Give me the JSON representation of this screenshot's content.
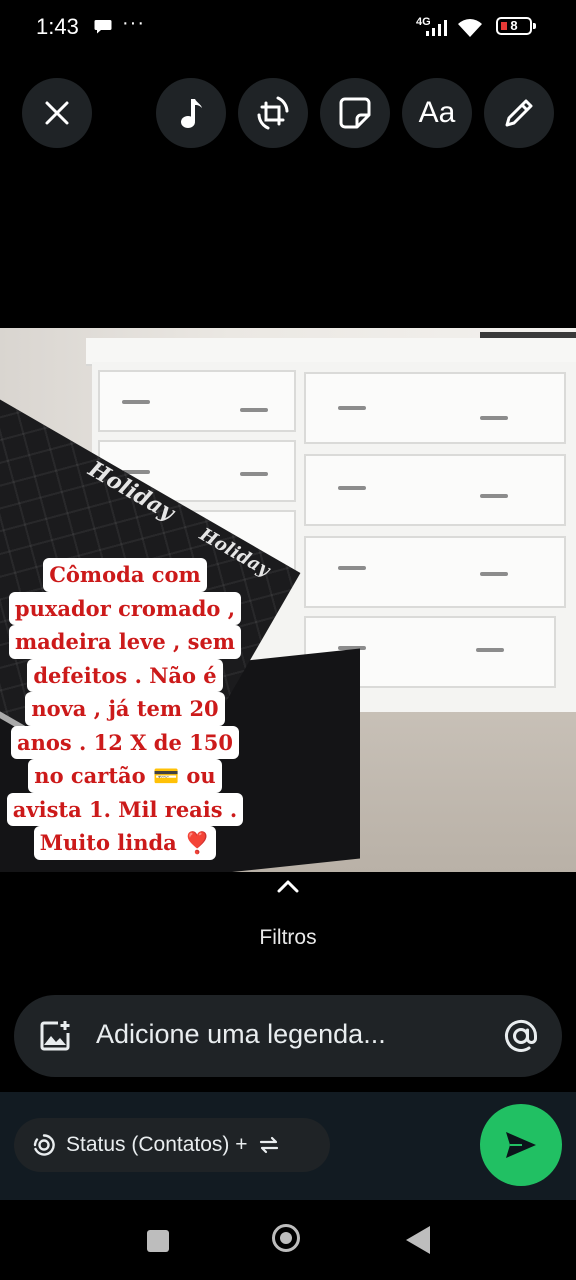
{
  "status_bar": {
    "time": "1:43",
    "dots": "···",
    "network": "4G",
    "battery": "8"
  },
  "toolbar": {
    "close_icon": "close-icon",
    "music_icon": "music-note-icon",
    "crop_icon": "crop-rotate-icon",
    "sticker_icon": "sticker-icon",
    "text_label": "Aa",
    "draw_icon": "pencil-icon"
  },
  "photo": {
    "brand_text_1": "Holiday",
    "brand_text_2": "Holiday",
    "caption_lines": [
      "Cômoda com",
      "puxador cromado ,",
      "madeira leve , sem",
      "defeitos . Não é",
      "nova , já tem 20",
      "anos .  12 X de 150",
      "no cartão 💳  ou",
      "avista 1. Mil reais .",
      "Muito linda ❣️"
    ]
  },
  "filters": {
    "label": "Filtros"
  },
  "caption_input": {
    "placeholder": "Adicione uma legenda..."
  },
  "bottom": {
    "status_label": "Status (Contatos) +"
  },
  "colors": {
    "accent_green": "#21c063",
    "caption_red": "#cc1a1a",
    "panel": "#1f2326"
  }
}
